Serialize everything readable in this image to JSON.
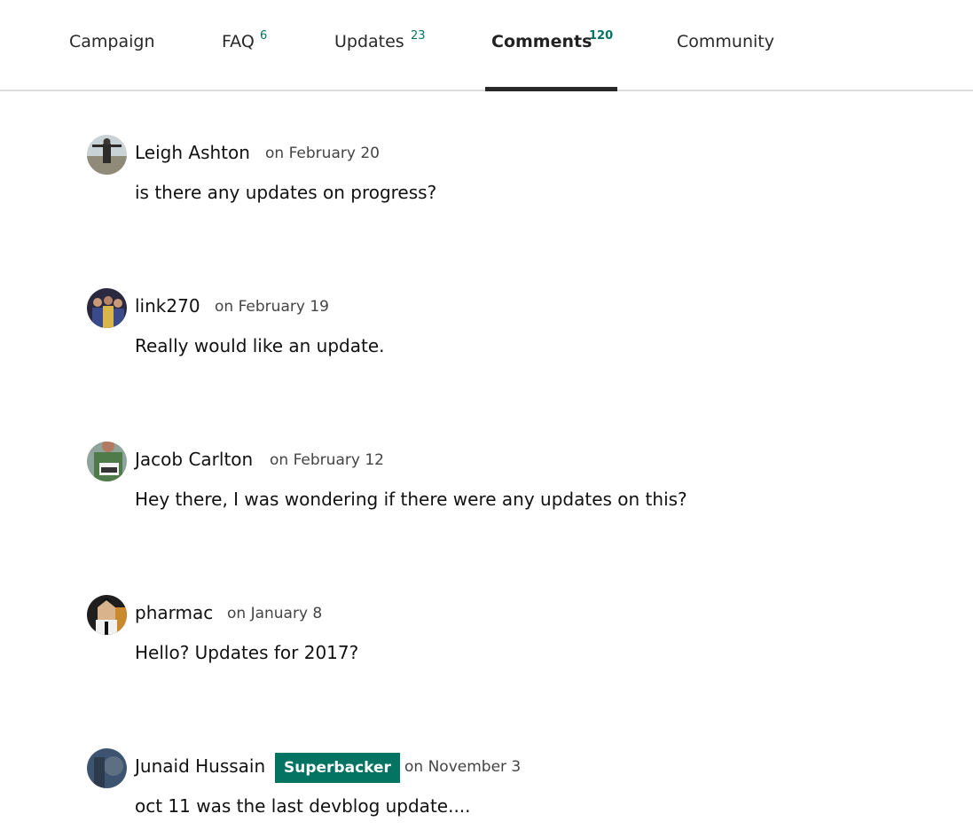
{
  "tabs": [
    {
      "label": "Campaign",
      "count": ""
    },
    {
      "label": "FAQ",
      "count": "6"
    },
    {
      "label": "Updates",
      "count": "23"
    },
    {
      "label": "Comments",
      "count": "120"
    },
    {
      "label": "Community",
      "count": ""
    }
  ],
  "active_tab": "Comments",
  "colors": {
    "accent": "#037362",
    "text": "#111111",
    "tab_underline": "#282828"
  },
  "comments": [
    {
      "author": "Leigh Ashton",
      "date": "on February 20",
      "text": "is there any updates on progress?",
      "badge": ""
    },
    {
      "author": "link270",
      "date": "on February 19",
      "text": "Really would like an update.",
      "badge": ""
    },
    {
      "author": "Jacob Carlton",
      "date": "on February 12",
      "text": "Hey there, I was wondering if there were any updates on this?",
      "badge": ""
    },
    {
      "author": "pharmac",
      "date": "on January 8",
      "text": "Hello? Updates for 2017?",
      "badge": ""
    },
    {
      "author": "Junaid Hussain",
      "date": "on November 3",
      "text": "oct 11 was the last devblog update....",
      "badge": "Superbacker"
    }
  ]
}
